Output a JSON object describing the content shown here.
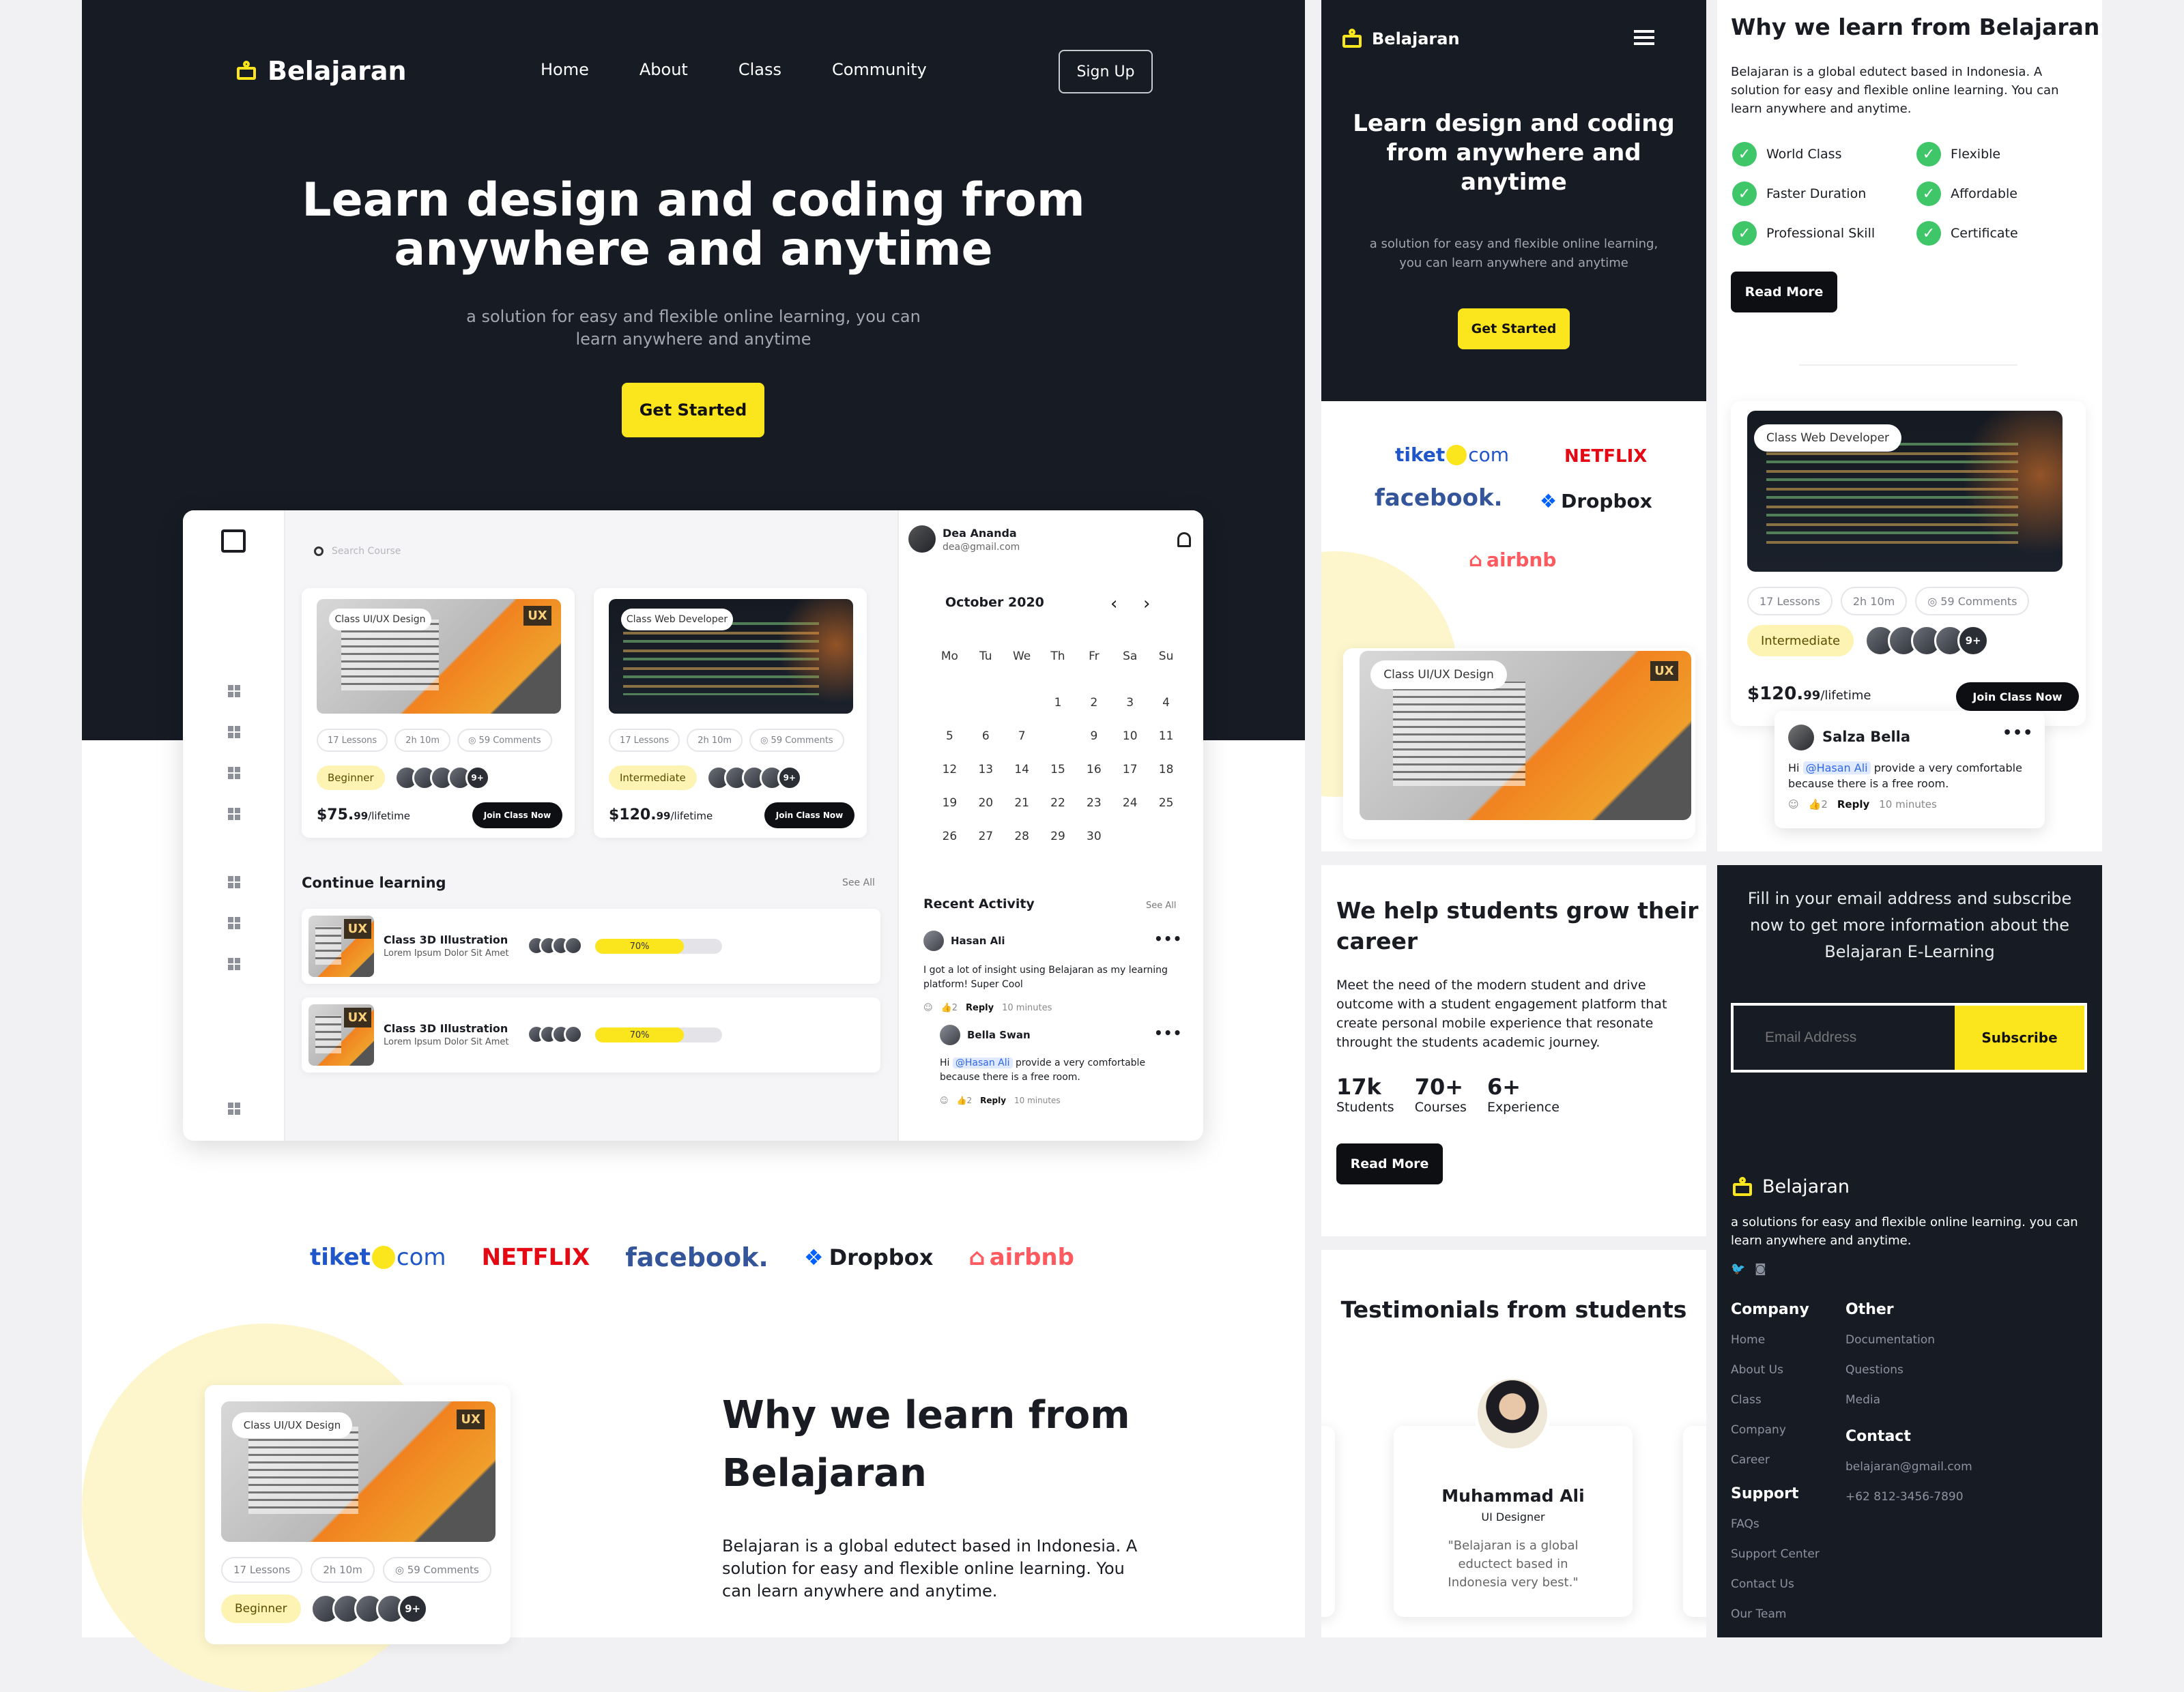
{
  "brand": "Belajaran",
  "nav": {
    "items": [
      "Home",
      "About",
      "Class",
      "Community"
    ],
    "signup": "Sign Up"
  },
  "hero": {
    "title_line1": "Learn design and coding from",
    "title_line2": "anywhere and anytime",
    "subtitle_line1": "a solution for easy and flexible online learning, you can",
    "subtitle_line2": "learn anywhere and anytime",
    "cta": "Get Started"
  },
  "dashboard": {
    "search_placeholder": "Search Course",
    "courses": [
      {
        "badge": "Class UI/UX Design",
        "lessons": "17 Lessons",
        "duration": "2h 10m",
        "comments": "59 Comments",
        "level": "Beginner",
        "more": "9+",
        "price": "$75.",
        "cents": "99",
        "per": "/lifetime",
        "cta": "Join Class Now"
      },
      {
        "badge": "Class Web Developer",
        "lessons": "17 Lessons",
        "duration": "2h 10m",
        "comments": "59 Comments",
        "level": "Intermediate",
        "more": "9+",
        "price": "$120.",
        "cents": "99",
        "per": "/lifetime",
        "cta": "Join Class Now"
      }
    ],
    "continue": {
      "title": "Continue learning",
      "see_all": "See All",
      "items": [
        {
          "title": "Class 3D Illustration",
          "sub": "Lorem Ipsum Dolor Sit Amet",
          "progress": 0.7,
          "progress_label": "70%"
        },
        {
          "title": "Class 3D Illustration",
          "sub": "Lorem Ipsum Dolor Sit Amet",
          "progress": 0.7,
          "progress_label": "70%"
        }
      ]
    },
    "user": {
      "name": "Dea Ananda",
      "email": "dea@gmail.com"
    },
    "calendar": {
      "month": "October 2020",
      "days": [
        "Mo",
        "Tu",
        "We",
        "Th",
        "Fr",
        "Sa",
        "Su"
      ],
      "weeks": [
        [
          "",
          "",
          "",
          "1",
          "2",
          "3",
          "4"
        ],
        [
          "5",
          "6",
          "7",
          "",
          "9",
          "10",
          "11"
        ],
        [
          "12",
          "13",
          "14",
          "15",
          "16",
          "17",
          "18"
        ],
        [
          "19",
          "20",
          "21",
          "22",
          "23",
          "24",
          "25"
        ],
        [
          "26",
          "27",
          "28",
          "29",
          "30",
          "",
          ""
        ]
      ]
    },
    "activity": {
      "title": "Recent Activity",
      "see_all": "See All",
      "c1": {
        "name": "Hasan Ali",
        "text": "I got a lot of insight using Belajaran as my learning platform! Super Cool",
        "likes": "2",
        "reply": "Reply",
        "time": "10 minutes"
      },
      "c2": {
        "name": "Bella Swan",
        "hi": "Hi",
        "mention": "@Hasan Ali",
        "text": "provide a very comfortable because there is a free room.",
        "likes": "2",
        "reply": "Reply",
        "time": "10 minutes"
      }
    }
  },
  "partners": [
    "tiket",
    "com",
    "NETFLIX",
    "facebook.",
    "Dropbox",
    "airbnb"
  ],
  "why": {
    "title_line1": "Why we learn from",
    "title_line2": "Belajaran",
    "title_full": "Why we learn from Belajaran",
    "body": "Belajaran is a global edutect based in Indonesia. A solution for easy and flexible online learning. You can learn anywhere and anytime.",
    "features": [
      "World Class",
      "Flexible",
      "Faster Duration",
      "Affordable",
      "Professional Skill",
      "Certificate"
    ],
    "cta": "Read More"
  },
  "left_card": {
    "badge": "Class UI/UX Design",
    "lessons": "17 Lessons",
    "duration": "2h 10m",
    "comments": "59 Comments",
    "level": "Beginner",
    "more": "9+"
  },
  "mobile": {
    "title_line1": "Learn design and coding",
    "title_line2": "from anywhere and",
    "title_line3": "anytime",
    "sub_line1": "a solution for easy and flexible online learning,",
    "sub_line2": "you can learn anywhere and anytime",
    "cta": "Get Started",
    "card_badge": "Class UI/UX Design"
  },
  "web_card": {
    "badge": "Class Web Developer",
    "lessons": "17 Lessons",
    "duration": "2h 10m",
    "comments": "59 Comments",
    "level": "Intermediate",
    "more": "9+",
    "price": "$120.",
    "cents": "99",
    "per": "/lifetime",
    "cta": "Join Class Now",
    "comment": {
      "name": "Salza Bella",
      "hi": "Hi",
      "mention": "@Hasan Ali",
      "text": "provide a very comfortable because there is a free room.",
      "likes": "2",
      "reply": "Reply",
      "time": "10 minutes"
    }
  },
  "grow": {
    "title_line1": "We help students grow their",
    "title_line2": "career",
    "body": "Meet the need of the modern student and drive outcome with a student engagement platform that create personal mobile experience that resonate throught the students academic journey.",
    "stats": [
      {
        "value": "17k",
        "label": "Students"
      },
      {
        "value": "70+",
        "label": "Courses"
      },
      {
        "value": "6+",
        "label": "Experience"
      }
    ],
    "cta": "Read More"
  },
  "testimonials": {
    "title": "Testimonials from students",
    "name": "Muhammad Ali",
    "role": "UI Designer",
    "quote": "\"Belajaran is a global eductect based in Indonesia very best.\""
  },
  "subscribe": {
    "text": "Fill in your email address and subscribe now to get more information about the Belajaran E-Learning",
    "placeholder": "Email Address",
    "cta": "Subscribe"
  },
  "footer": {
    "tagline": "a solutions for easy and flexible online learning. you can learn anywhere and anytime.",
    "company": {
      "title": "Company",
      "links": [
        "Home",
        "About Us",
        "Class",
        "Company",
        "Career"
      ]
    },
    "other": {
      "title": "Other",
      "links": [
        "Documentation",
        "Questions",
        "Media"
      ]
    },
    "contact": {
      "title": "Contact",
      "email": "belajaran@gmail.com",
      "phone": "+62 812-3456-7890"
    },
    "support": {
      "title": "Support",
      "links": [
        "FAQs",
        "Support Center",
        "Contact Us",
        "Our Team"
      ]
    }
  },
  "colors": {
    "accent": "#fbe51c",
    "dark": "#161b24",
    "check": "#3fc669"
  }
}
